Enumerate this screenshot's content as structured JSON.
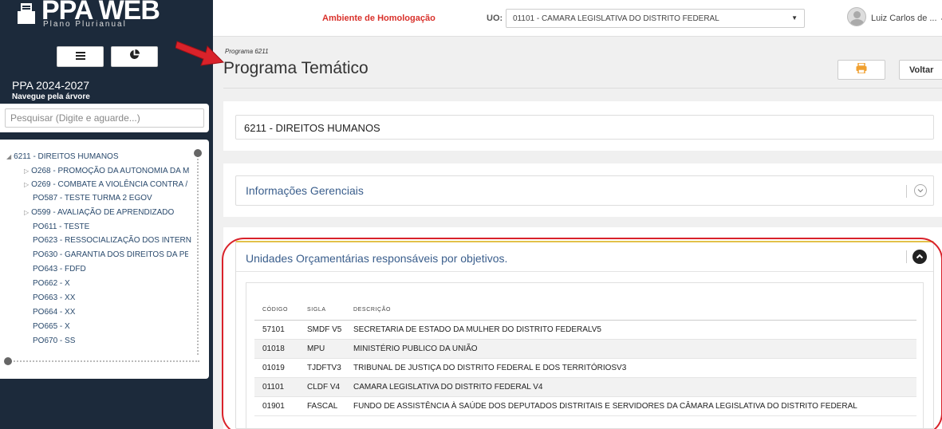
{
  "sidebar": {
    "logo_title": "PPA WEB",
    "logo_subtitle": "Plano Plurianual",
    "ppa_title": "PPA 2024-2027",
    "ppa_subtitle": "Navegue pela árvore",
    "search_placeholder": "Pesquisar (Digite e aguarde...)",
    "tree": [
      {
        "label": "6211 - DIREITOS HUMANOS",
        "level": 0,
        "expanded": true
      },
      {
        "label": "O268 - PROMOÇÃO DA AUTONOMIA DA M",
        "level": 1,
        "expandable": true
      },
      {
        "label": "O269 - COMBATE A VIOLÊNCIA CONTRA /",
        "level": 1,
        "expandable": true
      },
      {
        "label": "PO587 - TESTE TURMA 2 EGOV",
        "level": 1,
        "expandable": false
      },
      {
        "label": "O599 - AVALIAÇÃO DE APRENDIZADO",
        "level": 1,
        "expandable": true
      },
      {
        "label": "PO611 - TESTE",
        "level": 1,
        "expandable": false
      },
      {
        "label": "PO623 - RESSOCIALIZAÇÃO DOS INTERN",
        "level": 1,
        "expandable": false
      },
      {
        "label": "PO630 - GARANTIA DOS DIREITOS DA PE",
        "level": 1,
        "expandable": false
      },
      {
        "label": "PO643 - FDFD",
        "level": 1,
        "expandable": false
      },
      {
        "label": "PO662 - X",
        "level": 1,
        "expandable": false
      },
      {
        "label": "PO663 - XX",
        "level": 1,
        "expandable": false
      },
      {
        "label": "PO664 - XX",
        "level": 1,
        "expandable": false
      },
      {
        "label": "PO665 - X",
        "level": 1,
        "expandable": false
      },
      {
        "label": "PO670 - SS",
        "level": 1,
        "expandable": false
      }
    ]
  },
  "topbar": {
    "environment": "Ambiente de Homologação",
    "uo_label": "UO:",
    "uo_value": "01101 - CAMARA LEGISLATIVA DO DISTRITO FEDERAL",
    "user_name": "Luiz Carlos de ... ⌄"
  },
  "header": {
    "breadcrumb": "Programa 6211",
    "title": "Programa Temático",
    "back_label": "Voltar"
  },
  "program": {
    "value": "6211 - DIREITOS HUMANOS"
  },
  "info_section": {
    "title": "Informações Gerenciais"
  },
  "units_section": {
    "title": "Unidades Orçamentárias responsáveis por objetivos.",
    "columns": [
      "CÓDIGO",
      "SIGLA",
      "DESCRIÇÃO"
    ],
    "rows": [
      {
        "code": "57101",
        "sigla": "SMDF V5",
        "descricao": "SECRETARIA DE ESTADO DA MULHER DO DISTRITO FEDERALV5"
      },
      {
        "code": "01018",
        "sigla": "MPU",
        "descricao": "MINISTÉRIO PUBLICO DA UNIÃO"
      },
      {
        "code": "01019",
        "sigla": "TJDFTV3",
        "descricao": "TRIBUNAL DE JUSTIÇA DO DISTRITO FEDERAL E DOS TERRITÓRIOSV3"
      },
      {
        "code": "01101",
        "sigla": "CLDF V4",
        "descricao": "CAMARA LEGISLATIVA DO DISTRITO FEDERAL V4"
      },
      {
        "code": "01901",
        "sigla": "FASCAL",
        "descricao": "FUNDO DE ASSISTÊNCIA À SAÚDE DOS DEPUTADOS DISTRITAIS E SERVIDORES DA CÂMARA LEGISLATIVA DO DISTRITO FEDERAL"
      }
    ]
  },
  "colors": {
    "sidebar_bg": "#1c2a3b",
    "environment_text": "#d9312b",
    "section_title": "#3a5e8c",
    "annotation_red": "#d9222a",
    "print_icon": "#f0a030"
  }
}
